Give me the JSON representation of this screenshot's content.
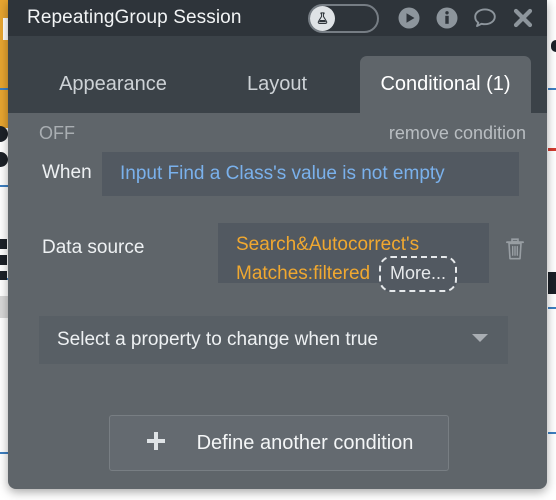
{
  "window": {
    "title": "RepeatingGroup Session",
    "actions": [
      {
        "name": "debug-toggle",
        "icon": "flask-icon",
        "state": "on"
      },
      {
        "name": "preview-button",
        "icon": "play-icon"
      },
      {
        "name": "info-button",
        "icon": "info-icon"
      },
      {
        "name": "comment-button",
        "icon": "comment-icon"
      },
      {
        "name": "close-button",
        "icon": "close-icon"
      }
    ]
  },
  "tabs": [
    {
      "label": "Appearance",
      "active": false
    },
    {
      "label": "Layout",
      "active": false
    },
    {
      "label": "Conditional (1)",
      "active": true
    }
  ],
  "condition": {
    "state_label": "OFF",
    "remove_label": "remove condition",
    "when_label": "When",
    "when_value": "Input Find a Class's value is not empty",
    "datasource_label": "Data source",
    "datasource_value_line1": "Search&Autocorrect's",
    "datasource_value_line2": "Matches:filtered",
    "datasource_more_label": "More...",
    "property_placeholder": "Select a property to change when true"
  },
  "footer": {
    "define_another_label": "Define another condition"
  },
  "colors": {
    "titlebar": "#2e343a",
    "tabstrip": "#3b4248",
    "panel": "#5f656a",
    "field": "#525961",
    "expression_blue": "#7ab1ec",
    "expression_orange": "#f0a830",
    "backdrop_orange": "#e8a530",
    "backdrop_rule": "#3d7fc1"
  }
}
